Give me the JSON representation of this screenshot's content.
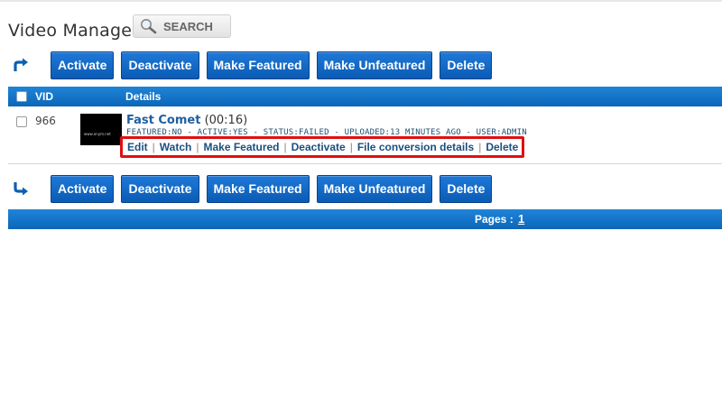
{
  "header": {
    "title": "Video Manager",
    "search_label": "SEARCH"
  },
  "actions": {
    "activate": "Activate",
    "deactivate": "Deactivate",
    "make_featured": "Make Featured",
    "make_unfeatured": "Make Unfeatured",
    "delete": "Delete"
  },
  "table": {
    "columns": [
      "VID",
      "Details"
    ],
    "rows": [
      {
        "vid": "966",
        "thumbnail_text": "www.onym.net",
        "title": "Fast Comet",
        "duration": "(00:16)",
        "meta": "FEATURED:NO - ACTIVE:YES - STATUS:FAILED - UPLOADED:13 MINUTES AGO - USER:ADMIN",
        "links": [
          "Edit",
          "Watch",
          "Make Featured",
          "Deactivate",
          "File conversion details",
          "Delete"
        ]
      }
    ]
  },
  "pagination": {
    "label": "Pages :",
    "current": "1"
  },
  "colors": {
    "button_blue": "#0a5cb4",
    "header_blue": "#0c66b8",
    "highlight_red": "#e01010",
    "link_blue": "#1a4f80"
  },
  "icons": {
    "search": "magnifier-icon",
    "top_arrow": "arrow-up-right-icon",
    "bottom_arrow": "arrow-down-right-icon"
  }
}
